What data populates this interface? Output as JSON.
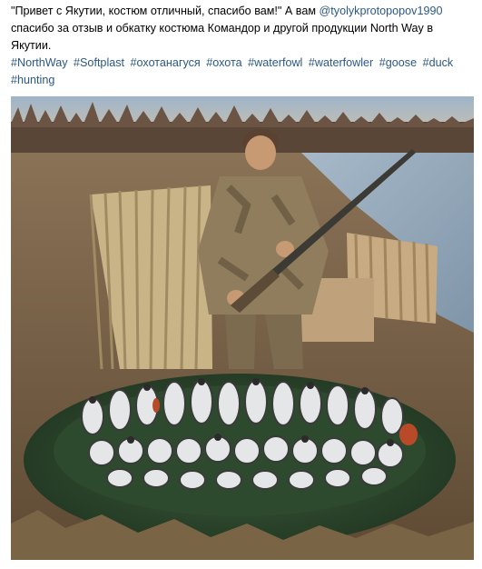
{
  "post": {
    "text_quote": "\"Привет с Якутии, костюм отличный, спасибо вам!\"",
    "text_mid": " А вам ",
    "mention": "@tyolykprotopopov1990",
    "text_rest": " спасибо за отзыв и обкатку костюма Командор и другой продукции North Way в Якутии.",
    "hashtags": [
      "#NorthWay",
      "#Softplast",
      "#охотанагуся",
      "#охота",
      "#waterfowl",
      "#waterfowler",
      "#goose",
      "#duck",
      "#hunting"
    ]
  },
  "colors": {
    "link": "#2a5885",
    "text": "#000000"
  }
}
